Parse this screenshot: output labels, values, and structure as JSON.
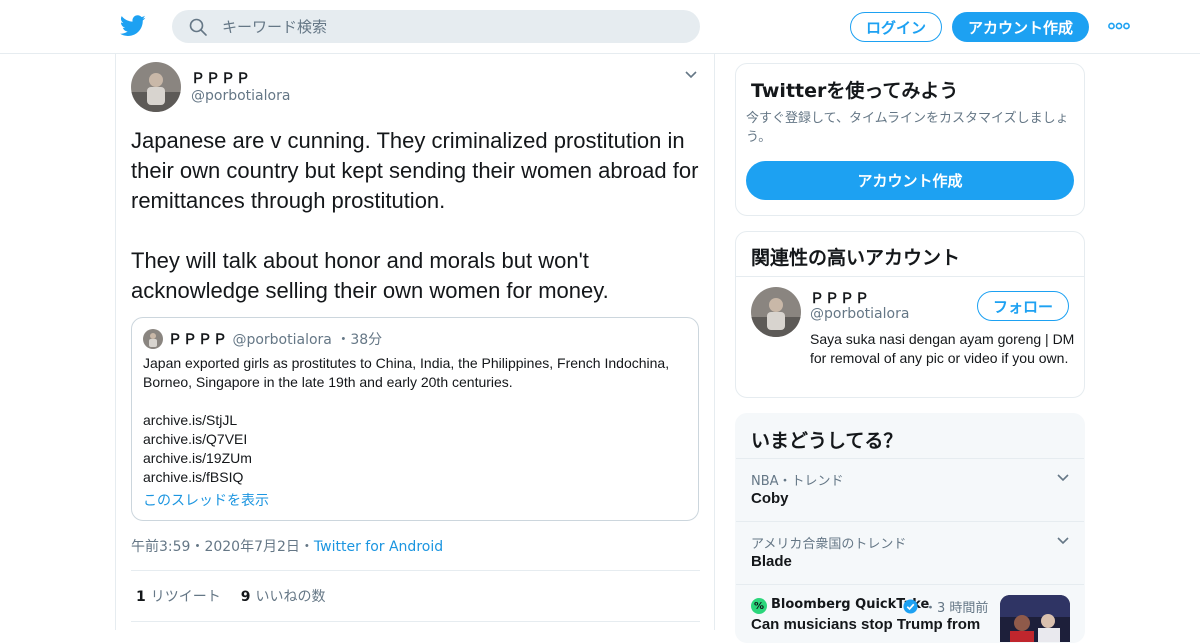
{
  "header": {
    "logo_icon": "twitter-bird-icon",
    "search": {
      "placeholder": "キーワード検索"
    },
    "login_label": "ログイン",
    "signup_label": "アカウント作成",
    "more_icon": "more-dots-icon",
    "accent_color": "#1da1f2"
  },
  "tweet": {
    "author_name": "ＰＰＰＰ",
    "author_handle": "@porbotialora",
    "text": "Japanese are v cunning. They criminalized prostitution in their own country but kept sending their women abroad for remittances through prostitution.\n\nThey will talk about honor and morals but won't acknowledge selling their own women for money.",
    "quote": {
      "author_name": "ＰＰＰＰ",
      "author_handle": "@porbotialora",
      "time": "38分",
      "text": "Japan exported girls as prostitutes to China, India, the Philippines, French Indochina, Borneo, Singapore in the late 19th and early 20th centuries.\n\narchive.is/StjJL\narchive.is/Q7VEI\narchive.is/19ZUm\narchive.is/fBSIQ",
      "thread_link": "このスレッドを表示"
    },
    "time": "午前3:59",
    "date": "2020年7月2日",
    "source": "Twitter for Android",
    "retweets_count": "1",
    "retweets_label": "リツイート",
    "likes_count": "9",
    "likes_label": "いいねの数"
  },
  "sidebar": {
    "signup_card": {
      "title": "Twitterを使ってみよう",
      "description": "今すぐ登録して、タイムラインをカスタマイズしましょう。",
      "button_label": "アカウント作成"
    },
    "related_card": {
      "title": "関連性の高いアカウント",
      "account": {
        "name": "ＰＰＰＰ",
        "handle": "@porbotialora",
        "follow_label": "フォロー",
        "bio": "Saya suka nasi dengan ayam goreng | DM for removal of any pic or video if you own."
      }
    },
    "trends_card": {
      "title": "いまどうしてる？",
      "trends": [
        {
          "meta": "NBA・トレンド",
          "name": "Coby"
        },
        {
          "meta": "アメリカ合衆国のトレンド",
          "name": "Blade"
        }
      ],
      "news": {
        "source": "Bloomberg QuickTake",
        "time": "3 時間前",
        "title": "Can musicians stop Trump from"
      }
    }
  }
}
